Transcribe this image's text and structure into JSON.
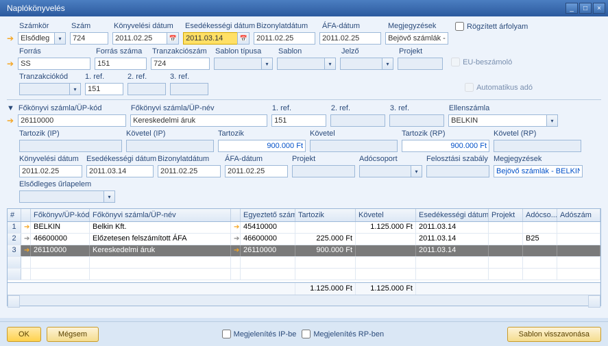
{
  "window": {
    "title": "Naplókönyvelés",
    "min": "_",
    "max": "□",
    "close": "×"
  },
  "top_labels": {
    "szamkor": "Számkör",
    "szam": "Szám",
    "konyv_datum": "Könyvelési dátum",
    "esed_datum": "Esedékességi dátum",
    "biz_datum": "Bizonylatdátum",
    "afa_datum": "ÁFA-dátum",
    "megj": "Megjegyzések",
    "rogz": "Rögzített árfolyam",
    "forras": "Forrás",
    "forras_szama": "Forrás száma",
    "tranz_szam": "Tranzakciószám",
    "sablon_tipus": "Sablon típusa",
    "sablon": "Sablon",
    "jelzo": "Jelző",
    "projekt": "Projekt",
    "eu": "EU-beszámoló",
    "tranz_kod": "Tranzakciókód",
    "ref1": "1. ref.",
    "ref2": "2. ref.",
    "ref3": "3. ref.",
    "auto_ado": "Automatikus adó"
  },
  "top_values": {
    "szamkor": "Elsődleg",
    "szam": "724",
    "konyv_datum": "2011.02.25",
    "esed_datum": "2011.03.14",
    "biz_datum": "2011.02.25",
    "afa_datum": "2011.02.25",
    "megj": "Bejövő számlák - B",
    "forras": "SS",
    "forras_szama": "151",
    "tranz_szam": "724",
    "ref1v": "151"
  },
  "mid_labels": {
    "fokonyv_kod": "Főkönyvi számla/ÜP-kód",
    "fokonyv_nev": "Főkönyvi számla/ÜP-név",
    "ref1": "1. ref.",
    "ref2": "2. ref.",
    "ref3": "3. ref.",
    "ellen": "Ellenszámla",
    "tartozik_ip": "Tartozik (IP)",
    "kovetel_ip": "Követel (IP)",
    "tartozik": "Tartozik",
    "kovetel": "Követel",
    "tartozik_rp": "Tartozik (RP)",
    "kovetel_rp": "Követel (RP)",
    "konyv_datum": "Könyvelési dátum",
    "esed_datum": "Esedékességi dátum",
    "biz_datum": "Bizonylatdátum",
    "afa_datum": "ÁFA-dátum",
    "projekt": "Projekt",
    "adocsoport": "Adócsoport",
    "felosztas": "Felosztási szabály",
    "megj": "Megjegyzések",
    "elso_urlap": "Elsődleges űrlapelem"
  },
  "mid_values": {
    "fokonyv_kod": "26110000",
    "fokonyv_nev": "Kereskedelmi áruk",
    "ref1": "151",
    "ellen": "BELKIN",
    "tartozik": "900.000 Ft",
    "tartozik_rp": "900.000 Ft",
    "konyv_datum": "2011.02.25",
    "esed_datum": "2011.03.14",
    "biz_datum": "2011.02.25",
    "afa_datum": "2011.02.25",
    "megj": "Bejövő számlák - BELKIN"
  },
  "grid": {
    "headers": {
      "num": "#",
      "fokonyv_kod": "Főkönyv/ÜP-kód",
      "fokonyv_nev": "Főkönyvi számla/ÜP-név",
      "egyezteto": "Egyeztető számla",
      "tartozik": "Tartozik",
      "kovetel": "Követel",
      "esed": "Esedékességi dátum",
      "projekt": "Projekt",
      "adocs": "Adócso...",
      "adoszam": "Adószám"
    },
    "rows": [
      {
        "n": "1",
        "kod": "BELKIN",
        "nev": "Belkin Kft.",
        "egy": "45410000",
        "tart": "",
        "kov": "1.125.000 Ft",
        "esed": "2011.03.14",
        "proj": "",
        "ado": "",
        "adsz": ""
      },
      {
        "n": "2",
        "kod": "46600000",
        "nev": "Előzetesen felszámított ÁFA",
        "egy": "46600000",
        "tart": "225.000 Ft",
        "kov": "",
        "esed": "2011.03.14",
        "proj": "",
        "ado": "B25",
        "adsz": ""
      },
      {
        "n": "3",
        "kod": "26110000",
        "nev": "Kereskedelmi áruk",
        "egy": "26110000",
        "tart": "900.000 Ft",
        "kov": "",
        "esed": "2011.03.14",
        "proj": "",
        "ado": "",
        "adsz": ""
      }
    ],
    "totals": {
      "tart": "1.125.000 Ft",
      "kov": "1.125.000 Ft"
    }
  },
  "footer": {
    "ok": "OK",
    "megsem": "Mégsem",
    "megj_ip": "Megjelenítés IP-be",
    "megj_rp": "Megjelenítés RP-ben",
    "sablon_vissza": "Sablon visszavonása"
  }
}
